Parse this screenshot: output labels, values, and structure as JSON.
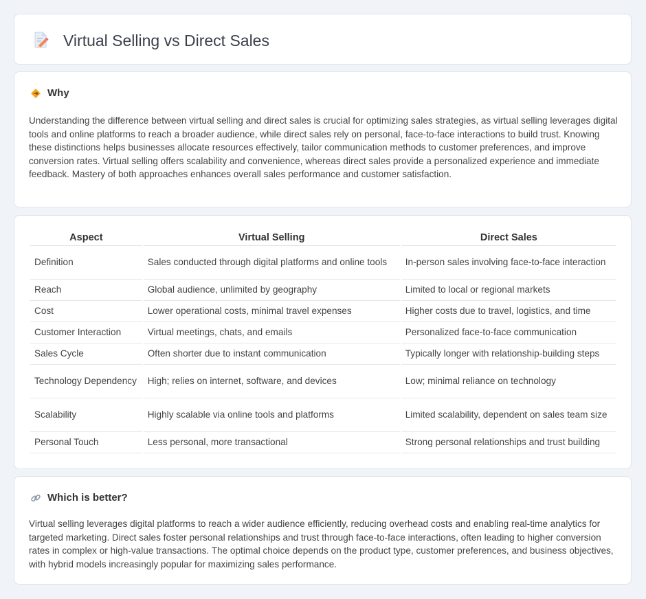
{
  "header": {
    "title": "Virtual Selling vs Direct Sales",
    "icon": "document-pencil-icon"
  },
  "why": {
    "icon": "diamond-warning-icon",
    "heading": "Why",
    "body": "Understanding the difference between virtual selling and direct sales is crucial for optimizing sales strategies, as virtual selling leverages digital tools and online platforms to reach a broader audience, while direct sales rely on personal, face-to-face interactions to build trust. Knowing these distinctions helps businesses allocate resources effectively, tailor communication methods to customer preferences, and improve conversion rates. Virtual selling offers scalability and convenience, whereas direct sales provide a personalized experience and immediate feedback. Mastery of both approaches enhances overall sales performance and customer satisfaction."
  },
  "comparison": {
    "headers": [
      "Aspect",
      "Virtual Selling",
      "Direct Sales"
    ],
    "rows": [
      [
        "Definition",
        "Sales conducted through digital platforms and online tools",
        "In-person sales involving face-to-face interaction"
      ],
      [
        "Reach",
        "Global audience, unlimited by geography",
        "Limited to local or regional markets"
      ],
      [
        "Cost",
        "Lower operational costs, minimal travel expenses",
        "Higher costs due to travel, logistics, and time"
      ],
      [
        "Customer Interaction",
        "Virtual meetings, chats, and emails",
        "Personalized face-to-face communication"
      ],
      [
        "Sales Cycle",
        "Often shorter due to instant communication",
        "Typically longer with relationship-building steps"
      ],
      [
        "Technology Dependency",
        "High; relies on internet, software, and devices",
        "Low; minimal reliance on technology"
      ],
      [
        "Scalability",
        "Highly scalable via online tools and platforms",
        "Limited scalability, dependent on sales team size"
      ],
      [
        "Personal Touch",
        "Less personal, more transactional",
        "Strong personal relationships and trust building"
      ]
    ]
  },
  "better": {
    "icon": "link-icon",
    "heading": "Which is better?",
    "body": "Virtual selling leverages digital platforms to reach a wider audience efficiently, reducing overhead costs and enabling real-time analytics for targeted marketing. Direct sales foster personal relationships and trust through face-to-face interactions, often leading to higher conversion rates in complex or high-value transactions. The optimal choice depends on the product type, customer preferences, and business objectives, with hybrid models increasingly popular for maximizing sales performance."
  },
  "colors": {
    "background": "#f0f3f8",
    "card": "#ffffff",
    "accent": "#f0a030"
  }
}
